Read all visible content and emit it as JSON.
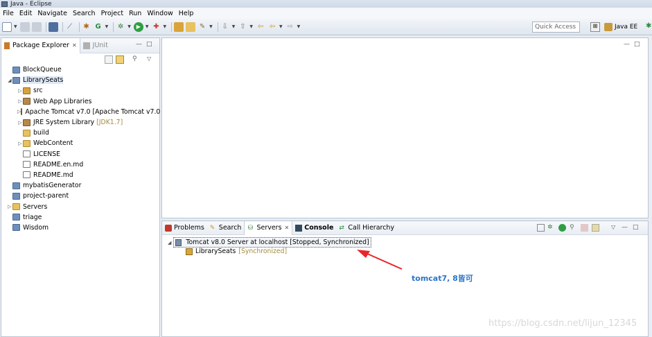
{
  "window": {
    "title": "Java - Eclipse"
  },
  "menu": [
    "File",
    "Edit",
    "Navigate",
    "Search",
    "Project",
    "Run",
    "Window",
    "Help"
  ],
  "toolbar": {
    "quick_access": "Quick Access",
    "perspective": "Java EE"
  },
  "left_view": {
    "tabs": [
      {
        "label": "Package Explorer",
        "active": true
      },
      {
        "label": "JUnit",
        "active": false
      }
    ],
    "tree": [
      {
        "label": "BlockQueue",
        "level": 0,
        "twisty": "",
        "icon": "project",
        "decoration": ""
      },
      {
        "label": "LibrarySeats",
        "level": 0,
        "twisty": "expanded",
        "icon": "project",
        "decoration": "",
        "selected": true
      },
      {
        "label": "src",
        "level": 1,
        "twisty": "collapsed",
        "icon": "package",
        "decoration": ""
      },
      {
        "label": "Web App Libraries",
        "level": 1,
        "twisty": "collapsed",
        "icon": "library",
        "decoration": ""
      },
      {
        "label": "Apache Tomcat v7.0 [Apache Tomcat v7.0",
        "level": 1,
        "twisty": "collapsed",
        "icon": "library",
        "decoration": ""
      },
      {
        "label": "JRE System Library",
        "level": 1,
        "twisty": "collapsed",
        "icon": "library",
        "decoration": "[JDK1.7]"
      },
      {
        "label": "build",
        "level": 1,
        "twisty": "",
        "icon": "folder",
        "decoration": ""
      },
      {
        "label": "WebContent",
        "level": 1,
        "twisty": "collapsed",
        "icon": "folder",
        "decoration": ""
      },
      {
        "label": "LICENSE",
        "level": 1,
        "twisty": "",
        "icon": "file",
        "decoration": ""
      },
      {
        "label": "README.en.md",
        "level": 1,
        "twisty": "",
        "icon": "file",
        "decoration": ""
      },
      {
        "label": "README.md",
        "level": 1,
        "twisty": "",
        "icon": "file",
        "decoration": ""
      },
      {
        "label": "mybatisGenerator",
        "level": 0,
        "twisty": "",
        "icon": "project",
        "decoration": ""
      },
      {
        "label": "project-parent",
        "level": 0,
        "twisty": "",
        "icon": "project",
        "decoration": ""
      },
      {
        "label": "Servers",
        "level": 0,
        "twisty": "collapsed",
        "icon": "folder",
        "decoration": ""
      },
      {
        "label": "triage",
        "level": 0,
        "twisty": "",
        "icon": "project",
        "decoration": ""
      },
      {
        "label": "Wisdom",
        "level": 0,
        "twisty": "",
        "icon": "project",
        "decoration": ""
      }
    ]
  },
  "bottom_view": {
    "tabs": [
      {
        "label": "Problems",
        "active": false,
        "bold": false
      },
      {
        "label": "Search",
        "active": false,
        "bold": false
      },
      {
        "label": "Servers",
        "active": true,
        "bold": false
      },
      {
        "label": "Console",
        "active": false,
        "bold": true
      },
      {
        "label": "Call Hierarchy",
        "active": false,
        "bold": false
      }
    ],
    "servers": [
      {
        "label": "Tomcat v8.0 Server at localhost  [Stopped, Synchronized]",
        "decoration": ""
      },
      {
        "label": "LibrarySeats",
        "decoration": "[Synchronized]"
      }
    ]
  },
  "annotation": {
    "text": "tomcat7, 8皆可",
    "color": "#e8262a"
  },
  "watermark": "https://blog.csdn.net/lijun_12345"
}
